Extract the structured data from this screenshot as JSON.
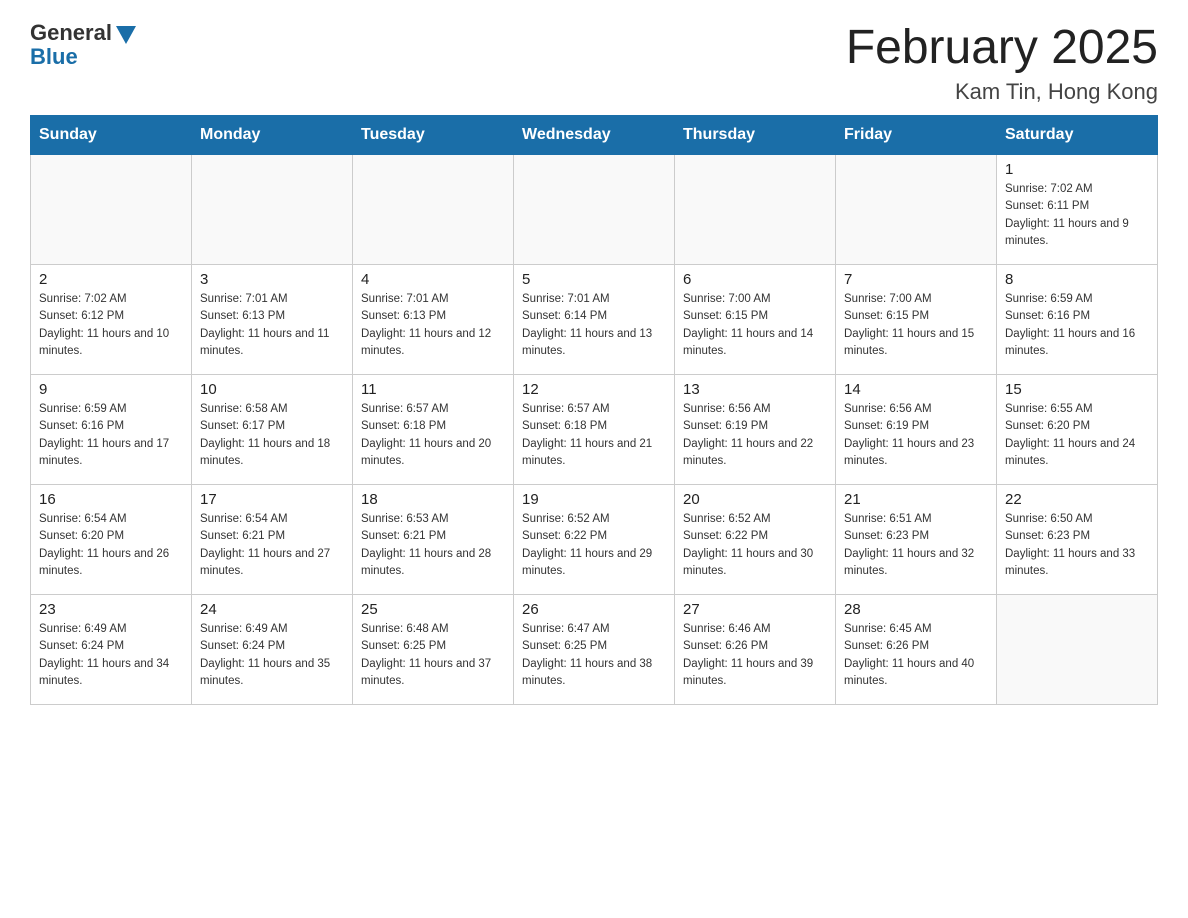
{
  "header": {
    "logo_general": "General",
    "logo_blue": "Blue",
    "month_title": "February 2025",
    "location": "Kam Tin, Hong Kong"
  },
  "weekdays": [
    "Sunday",
    "Monday",
    "Tuesday",
    "Wednesday",
    "Thursday",
    "Friday",
    "Saturday"
  ],
  "weeks": [
    [
      {
        "day": "",
        "info": ""
      },
      {
        "day": "",
        "info": ""
      },
      {
        "day": "",
        "info": ""
      },
      {
        "day": "",
        "info": ""
      },
      {
        "day": "",
        "info": ""
      },
      {
        "day": "",
        "info": ""
      },
      {
        "day": "1",
        "info": "Sunrise: 7:02 AM\nSunset: 6:11 PM\nDaylight: 11 hours and 9 minutes."
      }
    ],
    [
      {
        "day": "2",
        "info": "Sunrise: 7:02 AM\nSunset: 6:12 PM\nDaylight: 11 hours and 10 minutes."
      },
      {
        "day": "3",
        "info": "Sunrise: 7:01 AM\nSunset: 6:13 PM\nDaylight: 11 hours and 11 minutes."
      },
      {
        "day": "4",
        "info": "Sunrise: 7:01 AM\nSunset: 6:13 PM\nDaylight: 11 hours and 12 minutes."
      },
      {
        "day": "5",
        "info": "Sunrise: 7:01 AM\nSunset: 6:14 PM\nDaylight: 11 hours and 13 minutes."
      },
      {
        "day": "6",
        "info": "Sunrise: 7:00 AM\nSunset: 6:15 PM\nDaylight: 11 hours and 14 minutes."
      },
      {
        "day": "7",
        "info": "Sunrise: 7:00 AM\nSunset: 6:15 PM\nDaylight: 11 hours and 15 minutes."
      },
      {
        "day": "8",
        "info": "Sunrise: 6:59 AM\nSunset: 6:16 PM\nDaylight: 11 hours and 16 minutes."
      }
    ],
    [
      {
        "day": "9",
        "info": "Sunrise: 6:59 AM\nSunset: 6:16 PM\nDaylight: 11 hours and 17 minutes."
      },
      {
        "day": "10",
        "info": "Sunrise: 6:58 AM\nSunset: 6:17 PM\nDaylight: 11 hours and 18 minutes."
      },
      {
        "day": "11",
        "info": "Sunrise: 6:57 AM\nSunset: 6:18 PM\nDaylight: 11 hours and 20 minutes."
      },
      {
        "day": "12",
        "info": "Sunrise: 6:57 AM\nSunset: 6:18 PM\nDaylight: 11 hours and 21 minutes."
      },
      {
        "day": "13",
        "info": "Sunrise: 6:56 AM\nSunset: 6:19 PM\nDaylight: 11 hours and 22 minutes."
      },
      {
        "day": "14",
        "info": "Sunrise: 6:56 AM\nSunset: 6:19 PM\nDaylight: 11 hours and 23 minutes."
      },
      {
        "day": "15",
        "info": "Sunrise: 6:55 AM\nSunset: 6:20 PM\nDaylight: 11 hours and 24 minutes."
      }
    ],
    [
      {
        "day": "16",
        "info": "Sunrise: 6:54 AM\nSunset: 6:20 PM\nDaylight: 11 hours and 26 minutes."
      },
      {
        "day": "17",
        "info": "Sunrise: 6:54 AM\nSunset: 6:21 PM\nDaylight: 11 hours and 27 minutes."
      },
      {
        "day": "18",
        "info": "Sunrise: 6:53 AM\nSunset: 6:21 PM\nDaylight: 11 hours and 28 minutes."
      },
      {
        "day": "19",
        "info": "Sunrise: 6:52 AM\nSunset: 6:22 PM\nDaylight: 11 hours and 29 minutes."
      },
      {
        "day": "20",
        "info": "Sunrise: 6:52 AM\nSunset: 6:22 PM\nDaylight: 11 hours and 30 minutes."
      },
      {
        "day": "21",
        "info": "Sunrise: 6:51 AM\nSunset: 6:23 PM\nDaylight: 11 hours and 32 minutes."
      },
      {
        "day": "22",
        "info": "Sunrise: 6:50 AM\nSunset: 6:23 PM\nDaylight: 11 hours and 33 minutes."
      }
    ],
    [
      {
        "day": "23",
        "info": "Sunrise: 6:49 AM\nSunset: 6:24 PM\nDaylight: 11 hours and 34 minutes."
      },
      {
        "day": "24",
        "info": "Sunrise: 6:49 AM\nSunset: 6:24 PM\nDaylight: 11 hours and 35 minutes."
      },
      {
        "day": "25",
        "info": "Sunrise: 6:48 AM\nSunset: 6:25 PM\nDaylight: 11 hours and 37 minutes."
      },
      {
        "day": "26",
        "info": "Sunrise: 6:47 AM\nSunset: 6:25 PM\nDaylight: 11 hours and 38 minutes."
      },
      {
        "day": "27",
        "info": "Sunrise: 6:46 AM\nSunset: 6:26 PM\nDaylight: 11 hours and 39 minutes."
      },
      {
        "day": "28",
        "info": "Sunrise: 6:45 AM\nSunset: 6:26 PM\nDaylight: 11 hours and 40 minutes."
      },
      {
        "day": "",
        "info": ""
      }
    ]
  ]
}
